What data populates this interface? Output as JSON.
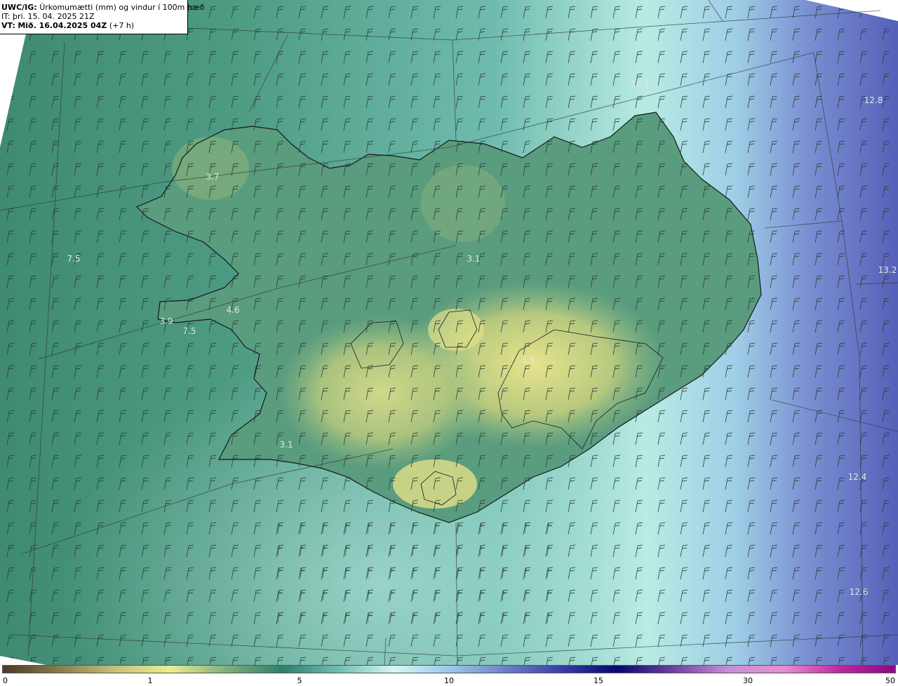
{
  "header": {
    "model": "UWC/IG:",
    "title": "Úrkomumætti (mm) og vindur í 100m hæð",
    "it_label": "IT:",
    "it_value": "þri. 15. 04. 2025 21Z",
    "vt_label": "VT:",
    "vt_value": "Mið. 16.04.2025 04Z",
    "vt_offset": "(+7 h)"
  },
  "map_labels": [
    {
      "text": "10.2"
    },
    {
      "text": "12.8"
    },
    {
      "text": "3.7"
    },
    {
      "text": "7.5"
    },
    {
      "text": "3.1"
    },
    {
      "text": "13.2"
    },
    {
      "text": "4.6"
    },
    {
      "text": "3.9"
    },
    {
      "text": "7.5"
    },
    {
      "text": "3.9"
    },
    {
      "text": "3.1"
    },
    {
      "text": "12.4"
    },
    {
      "text": "12.6"
    }
  ],
  "colorbar": {
    "ticks": [
      "0",
      "1",
      "5",
      "10",
      "15",
      "30",
      "50"
    ],
    "colors": [
      "#4a3a2a",
      "#8a7a4c",
      "#c7c07a",
      "#ecec8f",
      "#7fb07c",
      "#2f7e6c",
      "#6fbcb2",
      "#d9f6f2",
      "#9cc9ea",
      "#6f7fc7",
      "#3b3fa8",
      "#05086e",
      "#6e3d9e",
      "#c98fd7",
      "#e690d0",
      "#c0269e",
      "#8a0a80"
    ]
  }
}
